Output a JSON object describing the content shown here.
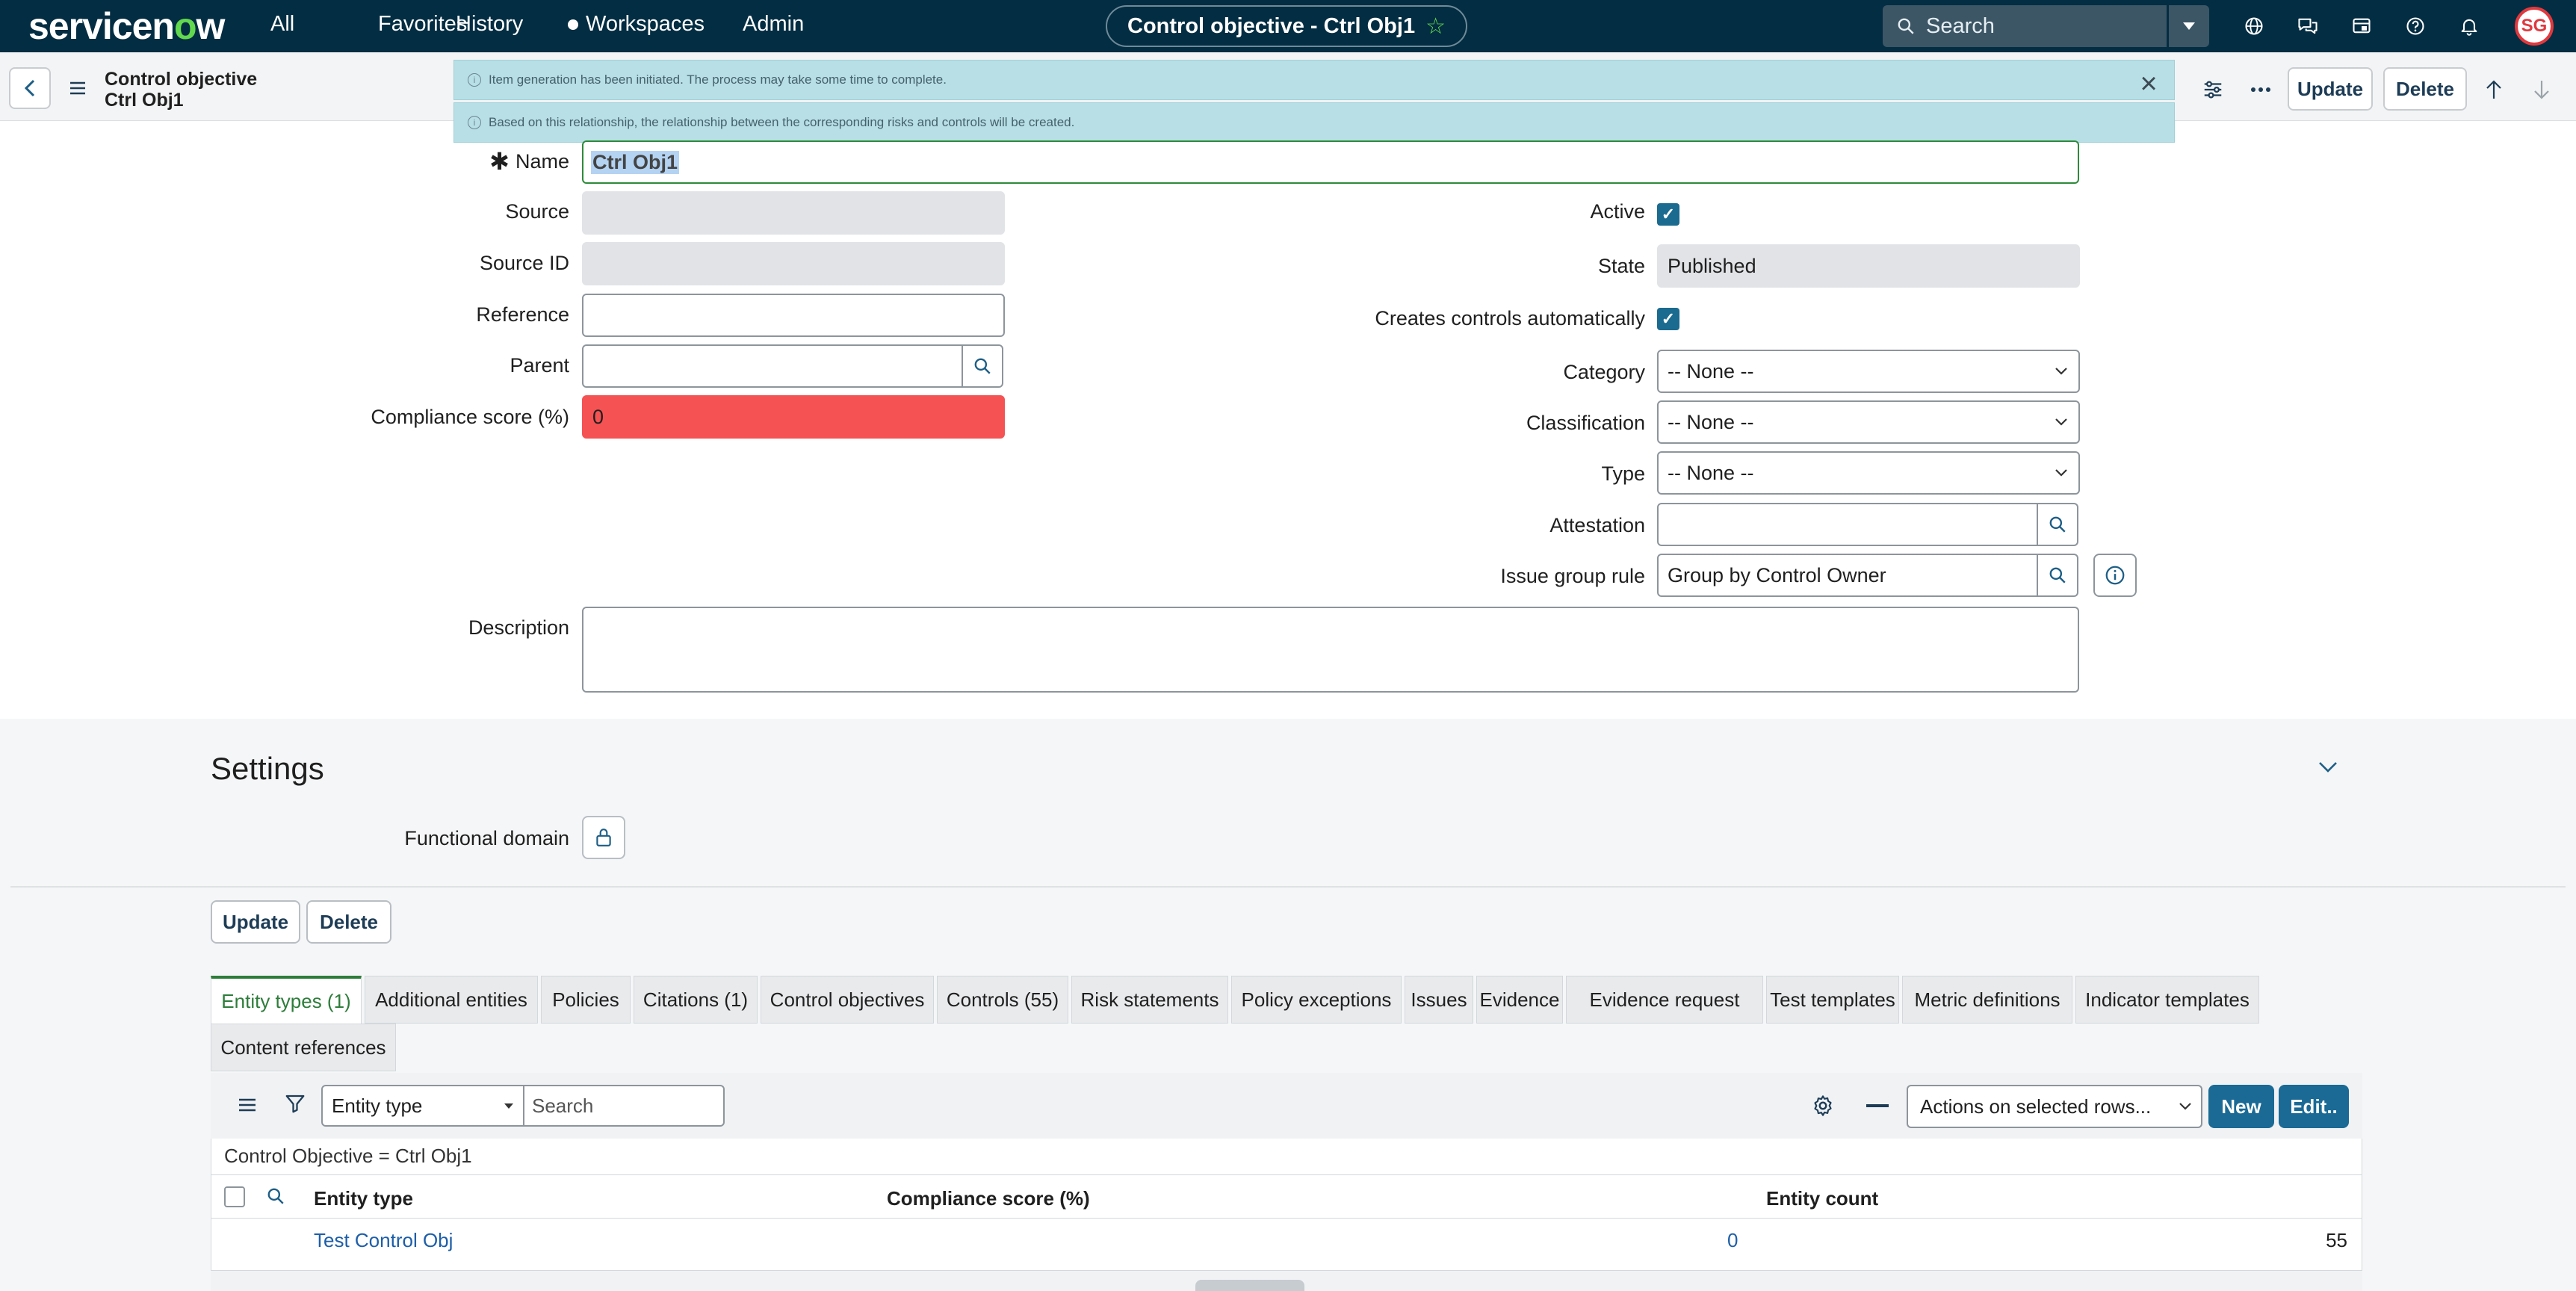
{
  "nav": {
    "logo_a": "servicen",
    "logo_o": "o",
    "logo_b": "w",
    "links": [
      "All",
      "Favorites",
      "History",
      "Workspaces",
      "Admin"
    ],
    "record_title": "Control objective - Ctrl Obj1",
    "search_placeholder": "Search",
    "avatar_initials": "SG"
  },
  "header": {
    "table_name": "Control objective",
    "record_name": "Ctrl Obj1",
    "update_label": "Update",
    "delete_label": "Delete"
  },
  "notifications": [
    "Item generation has been initiated. The process may take some time to complete.",
    "Based on this relationship, the relationship between the corresponding risks and controls will be created."
  ],
  "form": {
    "name_label": "Name",
    "name_value": "Ctrl Obj1",
    "source_label": "Source",
    "source_id_label": "Source ID",
    "reference_label": "Reference",
    "parent_label": "Parent",
    "compliance_label": "Compliance score (%)",
    "compliance_value": "0",
    "active_label": "Active",
    "state_label": "State",
    "state_value": "Published",
    "creates_label": "Creates controls automatically",
    "category_label": "Category",
    "category_value": "-- None --",
    "classification_label": "Classification",
    "classification_value": "-- None --",
    "type_label": "Type",
    "type_value": "-- None --",
    "attestation_label": "Attestation",
    "issue_group_label": "Issue group rule",
    "issue_group_value": "Group by Control Owner",
    "description_label": "Description"
  },
  "settings": {
    "title": "Settings",
    "functional_domain_label": "Functional domain",
    "update_label": "Update",
    "delete_label": "Delete"
  },
  "tabs": [
    "Entity types (1)",
    "Additional entities",
    "Policies",
    "Citations (1)",
    "Control objectives",
    "Controls (55)",
    "Risk statements",
    "Policy exceptions",
    "Issues",
    "Evidence",
    "Evidence request",
    "Test templates",
    "Metric definitions",
    "Indicator templates",
    "Content references"
  ],
  "related_list": {
    "filter_field": "Entity type",
    "search_placeholder": "Search",
    "actions_select": "Actions on selected rows...",
    "new_label": "New",
    "edit_label": "Edit..",
    "breadcrumb": "Control Objective = Ctrl Obj1",
    "columns": [
      "Entity type",
      "Compliance score (%)",
      "Entity count"
    ],
    "rows": [
      {
        "entity_type": "Test Control Obj",
        "compliance": "0",
        "count": "55"
      }
    ]
  },
  "colors": {
    "nav_bg": "#032d42",
    "accent_green": "#62d84e",
    "compliance_red": "#f55253",
    "primary_blue": "#1a6a95"
  }
}
